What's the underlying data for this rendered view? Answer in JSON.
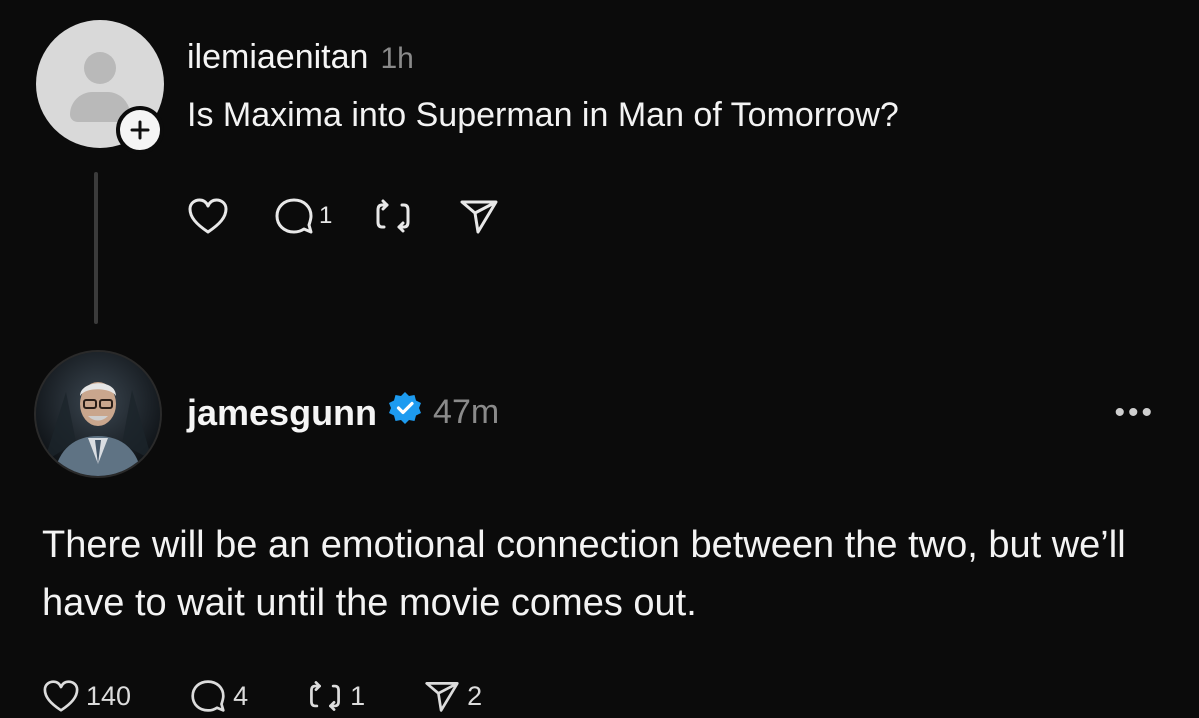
{
  "post1": {
    "username": "ilemiaenitan",
    "time": "1h",
    "text": "Is Maxima into Superman in Man of Tomorrow?",
    "actions": {
      "like_count": "",
      "reply_count": "1",
      "repost_count": "",
      "share_count": ""
    }
  },
  "post2": {
    "username": "jamesgunn",
    "verified": true,
    "time": "47m",
    "more_label": "•••",
    "text": "There will be an emotional connection between the two, but we’ll have to wait until the movie comes out.",
    "actions": {
      "like_count": "140",
      "reply_count": "4",
      "repost_count": "1",
      "share_count": "2"
    }
  },
  "colors": {
    "background": "#0b0b0b",
    "text": "#f3f3f3",
    "muted": "#8a8a8a",
    "verified": "#1d9bf0"
  },
  "icons": [
    "heart-icon",
    "comment-icon",
    "repost-icon",
    "share-icon",
    "verified-icon",
    "plus-icon",
    "more-icon"
  ]
}
